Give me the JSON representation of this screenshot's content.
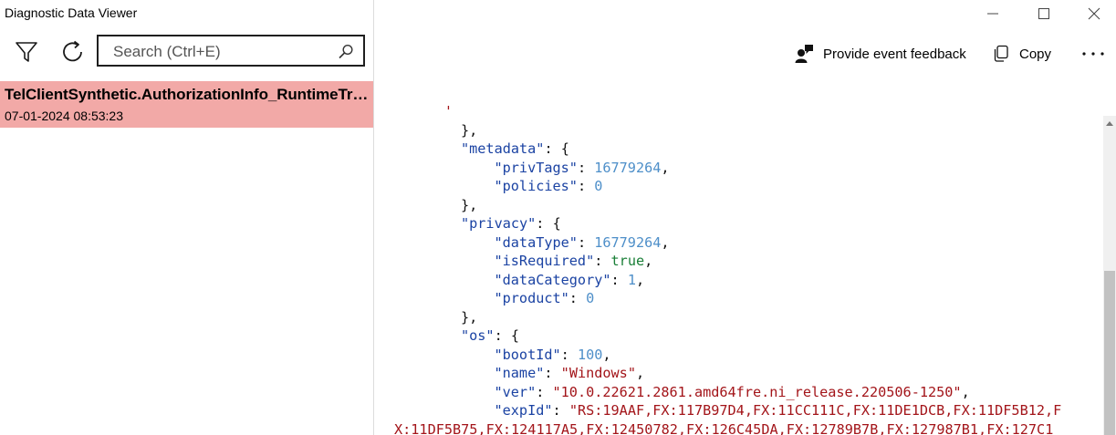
{
  "window": {
    "title": "Diagnostic Data Viewer"
  },
  "toolbar": {
    "filter_icon": "filter-icon",
    "refresh_icon": "refresh-icon",
    "search_placeholder": "Search (Ctrl+E)",
    "search_value": ""
  },
  "events": [
    {
      "name": "TelClientSynthetic.AuthorizationInfo_RuntimeTra...",
      "timestamp": "07-01-2024 08:53:23",
      "selected": true,
      "highlight_color": "#f2a9a7"
    }
  ],
  "actions": {
    "feedback_label": "Provide event feedback",
    "copy_label": "Copy",
    "more_label": "..."
  },
  "json_lines": [
    {
      "indent": 0,
      "parts": [
        {
          "t": "s",
          "v": "      '"
        }
      ]
    },
    {
      "indent": 2,
      "parts": [
        {
          "t": "p",
          "v": "},"
        }
      ]
    },
    {
      "indent": 2,
      "parts": [
        {
          "t": "k",
          "v": "\"metadata\""
        },
        {
          "t": "p",
          "v": ": {"
        }
      ]
    },
    {
      "indent": 3,
      "parts": [
        {
          "t": "k",
          "v": "\"privTags\""
        },
        {
          "t": "p",
          "v": ": "
        },
        {
          "t": "n",
          "v": "16779264"
        },
        {
          "t": "p",
          "v": ","
        }
      ]
    },
    {
      "indent": 3,
      "parts": [
        {
          "t": "k",
          "v": "\"policies\""
        },
        {
          "t": "p",
          "v": ": "
        },
        {
          "t": "n",
          "v": "0"
        }
      ]
    },
    {
      "indent": 2,
      "parts": [
        {
          "t": "p",
          "v": "},"
        }
      ]
    },
    {
      "indent": 2,
      "parts": [
        {
          "t": "k",
          "v": "\"privacy\""
        },
        {
          "t": "p",
          "v": ": {"
        }
      ]
    },
    {
      "indent": 3,
      "parts": [
        {
          "t": "k",
          "v": "\"dataType\""
        },
        {
          "t": "p",
          "v": ": "
        },
        {
          "t": "n",
          "v": "16779264"
        },
        {
          "t": "p",
          "v": ","
        }
      ]
    },
    {
      "indent": 3,
      "parts": [
        {
          "t": "k",
          "v": "\"isRequired\""
        },
        {
          "t": "p",
          "v": ": "
        },
        {
          "t": "b",
          "v": "true"
        },
        {
          "t": "p",
          "v": ","
        }
      ]
    },
    {
      "indent": 3,
      "parts": [
        {
          "t": "k",
          "v": "\"dataCategory\""
        },
        {
          "t": "p",
          "v": ": "
        },
        {
          "t": "n",
          "v": "1"
        },
        {
          "t": "p",
          "v": ","
        }
      ]
    },
    {
      "indent": 3,
      "parts": [
        {
          "t": "k",
          "v": "\"product\""
        },
        {
          "t": "p",
          "v": ": "
        },
        {
          "t": "n",
          "v": "0"
        }
      ]
    },
    {
      "indent": 2,
      "parts": [
        {
          "t": "p",
          "v": "},"
        }
      ]
    },
    {
      "indent": 2,
      "parts": [
        {
          "t": "k",
          "v": "\"os\""
        },
        {
          "t": "p",
          "v": ": {"
        }
      ]
    },
    {
      "indent": 3,
      "parts": [
        {
          "t": "k",
          "v": "\"bootId\""
        },
        {
          "t": "p",
          "v": ": "
        },
        {
          "t": "n",
          "v": "100"
        },
        {
          "t": "p",
          "v": ","
        }
      ]
    },
    {
      "indent": 3,
      "parts": [
        {
          "t": "k",
          "v": "\"name\""
        },
        {
          "t": "p",
          "v": ": "
        },
        {
          "t": "s",
          "v": "\"Windows\""
        },
        {
          "t": "p",
          "v": ","
        }
      ]
    },
    {
      "indent": 3,
      "parts": [
        {
          "t": "k",
          "v": "\"ver\""
        },
        {
          "t": "p",
          "v": ": "
        },
        {
          "t": "s",
          "v": "\"10.0.22621.2861.amd64fre.ni_release.220506-1250\""
        },
        {
          "t": "p",
          "v": ","
        }
      ]
    },
    {
      "indent": 3,
      "parts": [
        {
          "t": "k",
          "v": "\"expId\""
        },
        {
          "t": "p",
          "v": ": "
        },
        {
          "t": "s",
          "v": "\"RS:19AAF,FX:117B97D4,FX:11CC111C,FX:11DE1DCB,FX:11DF5B12,F"
        }
      ]
    },
    {
      "indent": 0,
      "parts": [
        {
          "t": "s",
          "v": "X:11DF5B75,FX:124117A5,FX:12450782,FX:126C45DA,FX:12789B7B,FX:127987B1,FX:127C1"
        }
      ]
    }
  ],
  "colors": {
    "key": "#1b43a3",
    "number": "#4e8fc9",
    "string": "#a3151a",
    "boolean": "#1a7f37",
    "selection": "#f2a9a7"
  }
}
